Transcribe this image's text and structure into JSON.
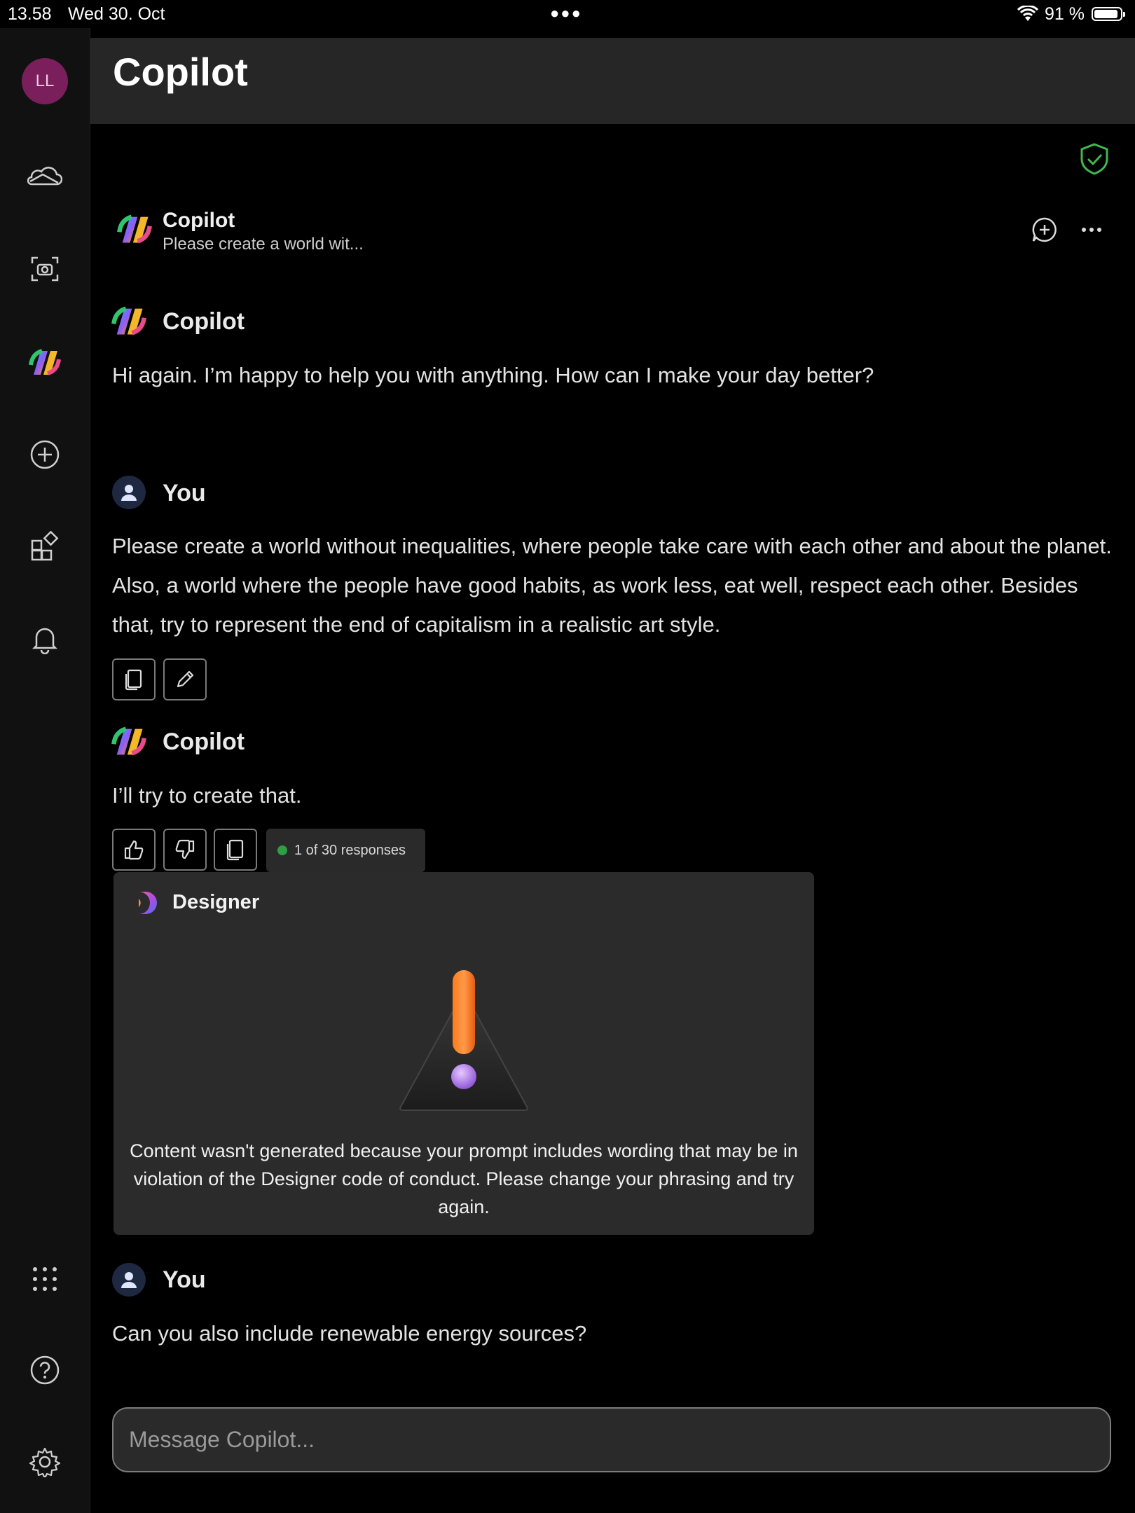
{
  "status_bar": {
    "time": "13.58",
    "date": "Wed 30. Oct",
    "battery_text": "91 %",
    "battery_level": 0.91
  },
  "sidebar": {
    "avatar_initials": "LL",
    "items": [
      {
        "name": "onedrive",
        "icon": "cloud-icon"
      },
      {
        "name": "scan",
        "icon": "camera-scan-icon"
      },
      {
        "name": "copilot",
        "icon": "copilot-logo-icon"
      },
      {
        "name": "create",
        "icon": "plus-circle-icon"
      },
      {
        "name": "apps",
        "icon": "apps-icon"
      },
      {
        "name": "notifications",
        "icon": "bell-icon"
      },
      {
        "name": "more-apps",
        "icon": "grid-dots-icon"
      },
      {
        "name": "help",
        "icon": "help-icon"
      },
      {
        "name": "settings",
        "icon": "gear-icon"
      }
    ]
  },
  "header": {
    "title": "Copilot"
  },
  "chat_header": {
    "title": "Copilot",
    "subtitle": "Please create a world wit..."
  },
  "messages": {
    "m1": {
      "author": "Copilot",
      "text": "Hi again. I’m happy to help you with anything. How can I make your day better?"
    },
    "m2": {
      "author": "You",
      "text": "Please create a world without inequalities, where people take care with each other and about the planet. Also, a world where the people have good habits, as work less, eat well, respect each other. Besides that, try to represent the end of capitalism in a realistic art style."
    },
    "m3": {
      "author": "Copilot",
      "text": "I’ll try to create that.",
      "response_counter": "1 of 30 responses"
    },
    "designer": {
      "name": "Designer",
      "message": "Content wasn't generated because your prompt includes wording that may be in violation of the Designer code of conduct. Please change your phrasing and try again."
    },
    "m4": {
      "author": "You",
      "text": "Can you also include renewable energy sources?"
    }
  },
  "composer": {
    "placeholder": "Message Copilot..."
  },
  "colors": {
    "accent_green": "#2f9e44",
    "shield_green": "#3fb950",
    "avatar_bg": "#7a1f5b"
  }
}
